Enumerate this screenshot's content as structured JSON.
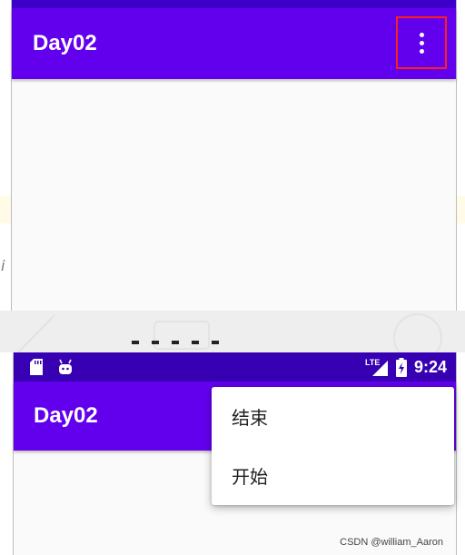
{
  "top_screen": {
    "app_title": "Day02",
    "overflow_icon": "more-vert-icon",
    "highlight_color": "#ff1e1e"
  },
  "bottom_screen": {
    "status_bar": {
      "left_icons": [
        "sd-card-icon",
        "android-icon"
      ],
      "network_label": "LTE",
      "right_icons": [
        "signal-icon",
        "battery-charging-icon"
      ],
      "time": "9:24"
    },
    "app_title": "Day02",
    "popup_menu": {
      "items": [
        "结束",
        "开始"
      ]
    }
  },
  "watermark": "CSDN @william_Aaron",
  "colors": {
    "primary": "#6200ee",
    "primary_dark": "#3700b3",
    "background": "#fafafa"
  }
}
